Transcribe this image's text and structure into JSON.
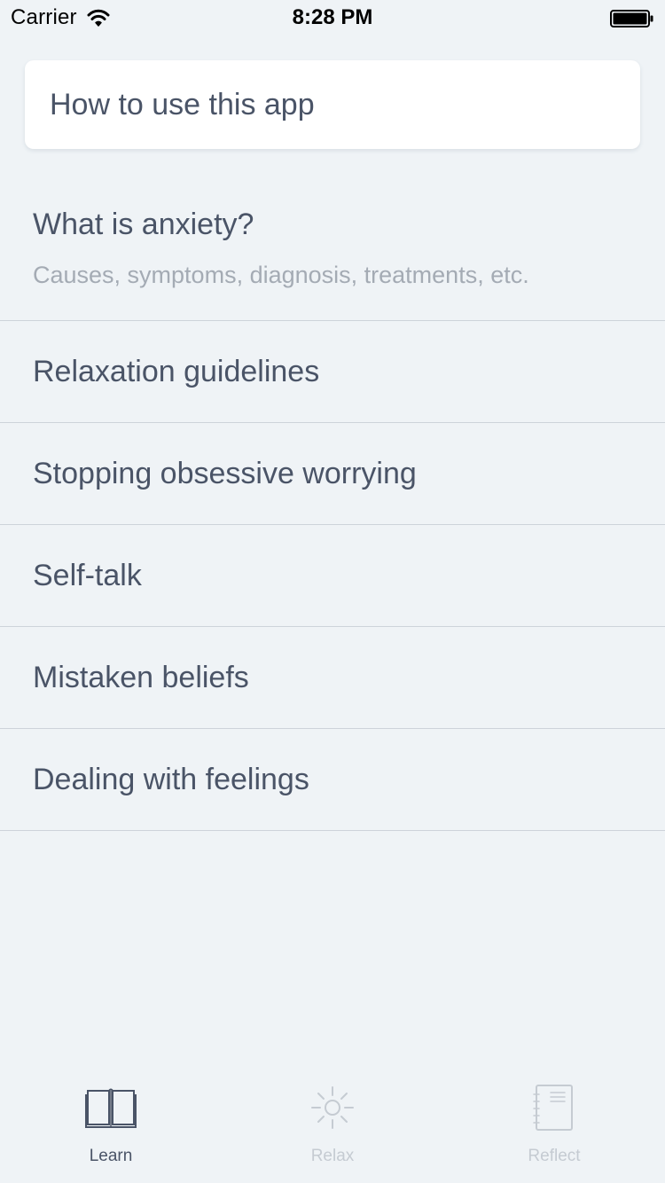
{
  "status_bar": {
    "carrier": "Carrier",
    "time": "8:28 PM",
    "wifi_icon": "wifi-icon",
    "battery_icon": "battery-full-icon"
  },
  "intro_card": {
    "label": "How to use this app"
  },
  "topics": [
    {
      "title": "What is anxiety?",
      "subtitle": "Causes, symptoms, diagnosis, treatments, etc."
    },
    {
      "title": "Relaxation guidelines"
    },
    {
      "title": "Stopping obsessive worrying"
    },
    {
      "title": "Self-talk"
    },
    {
      "title": "Mistaken beliefs"
    },
    {
      "title": "Dealing with feelings"
    }
  ],
  "tab_bar": {
    "tabs": [
      {
        "label": "Learn",
        "icon": "book-icon",
        "active": true
      },
      {
        "label": "Relax",
        "icon": "sun-icon",
        "active": false
      },
      {
        "label": "Reflect",
        "icon": "notebook-icon",
        "active": false
      }
    ]
  },
  "colors": {
    "background": "#eff3f6",
    "text_primary": "#4a5467",
    "text_secondary": "#a4abb4",
    "divider": "#cdd3da",
    "tab_inactive": "#c5cbd2"
  }
}
